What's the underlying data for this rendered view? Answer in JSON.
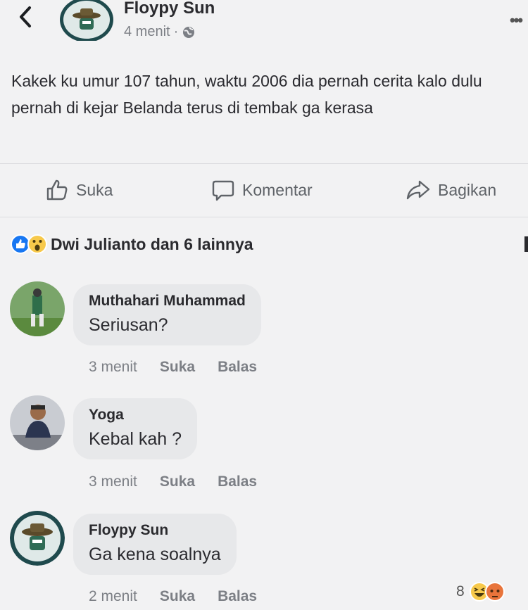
{
  "post": {
    "author": "Floypy Sun",
    "time": "4 menit",
    "separator": "·",
    "text": "Kakek ku umur 107 tahun, waktu 2006 dia pernah cerita kalo dulu pernah di kejar Belanda terus di tembak ga kerasa"
  },
  "actions": {
    "like": "Suka",
    "comment": "Komentar",
    "share": "Bagikan"
  },
  "reactions": {
    "summary": "Dwi Julianto dan 6 lainnya",
    "icons": [
      "like-icon",
      "wow-icon"
    ]
  },
  "comments": [
    {
      "author": "Muthahari Muhammad",
      "text": "Seriusan?",
      "time": "3 menit",
      "like": "Suka",
      "reply": "Balas"
    },
    {
      "author": "Yoga",
      "text": "Kebal kah ?",
      "time": "3 menit",
      "like": "Suka",
      "reply": "Balas"
    },
    {
      "author": "Floypy Sun",
      "text": "Ga kena soalnya",
      "time": "2 menit",
      "like": "Suka",
      "reply": "Balas",
      "reaction_count": "8"
    }
  ],
  "colors": {
    "background": "#f2f2f3",
    "bubble": "#e7e8ea",
    "like_blue": "#1877f2",
    "avatar_dark": "#1f4a4d"
  }
}
